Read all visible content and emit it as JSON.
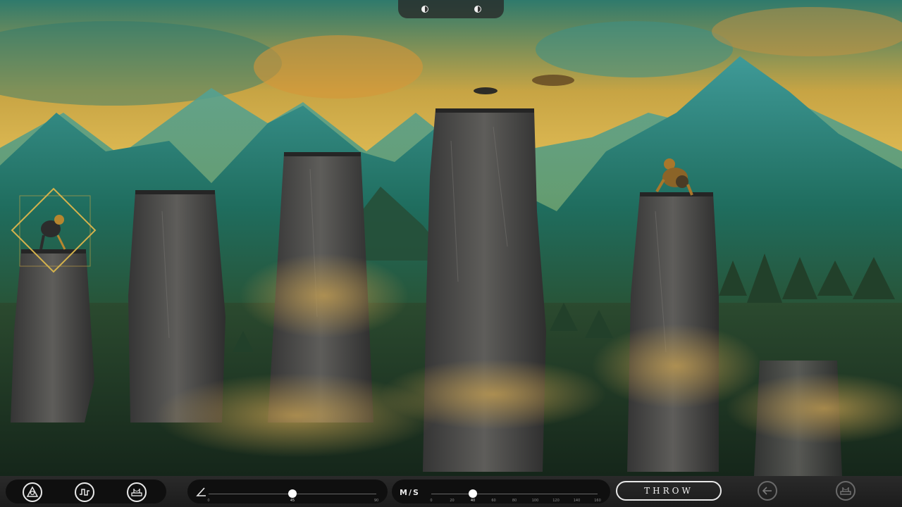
{
  "hud": {
    "player1_icon": "moon-half-icon",
    "player2_icon": "moon-half-icon"
  },
  "toolbar": {
    "left_icons": [
      "weather-icon",
      "pulse-icon",
      "bridge-icon"
    ],
    "angle": {
      "icon": "angle-icon",
      "value": 45,
      "min": 0,
      "max": 90,
      "ticks": [
        "0",
        "45",
        "90"
      ]
    },
    "velocity": {
      "label": "M/S",
      "value": 40,
      "min": 0,
      "max": 160,
      "ticks": [
        "0",
        "20",
        "40",
        "60",
        "80",
        "100",
        "120",
        "140",
        "160"
      ]
    },
    "throw_label": "THROW",
    "right_icons": [
      "back-arrow-icon",
      "bridge-icon"
    ]
  },
  "colors": {
    "sky_gold": "#e8b84a",
    "mountain_teal": "#2f8a86",
    "rock_gray": "#4a4a4a",
    "selection_gold": "#c9a545"
  }
}
